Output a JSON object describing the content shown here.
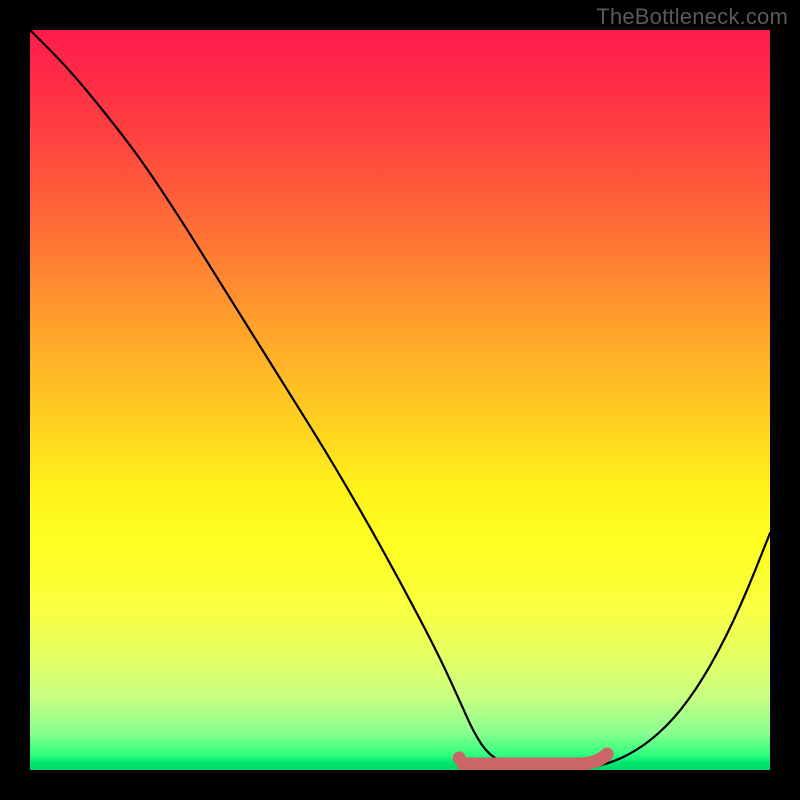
{
  "watermark": "TheBottleneck.com",
  "chart_data": {
    "type": "line",
    "title": "",
    "xlabel": "",
    "ylabel": "",
    "xlim": [
      0,
      100
    ],
    "ylim": [
      0,
      100
    ],
    "series": [
      {
        "name": "bottleneck-curve",
        "x": [
          0,
          5,
          10,
          15,
          20,
          25,
          30,
          35,
          40,
          45,
          50,
          55,
          58,
          60,
          62,
          65,
          68,
          72,
          76,
          80,
          84,
          88,
          92,
          96,
          100
        ],
        "y": [
          100,
          95,
          89,
          82.5,
          75,
          67,
          59,
          51,
          43,
          34.5,
          25.5,
          16,
          9.5,
          5,
          2,
          0.5,
          0,
          0,
          0.3,
          1.5,
          4,
          8,
          14,
          22,
          32
        ]
      }
    ],
    "highlight": {
      "name": "optimal-range",
      "x_start": 58,
      "x_end": 78,
      "y": 0
    },
    "background_gradient": {
      "top_color": "#ff1a4d",
      "mid_color": "#fff21a",
      "bottom_color": "#00d868"
    }
  }
}
